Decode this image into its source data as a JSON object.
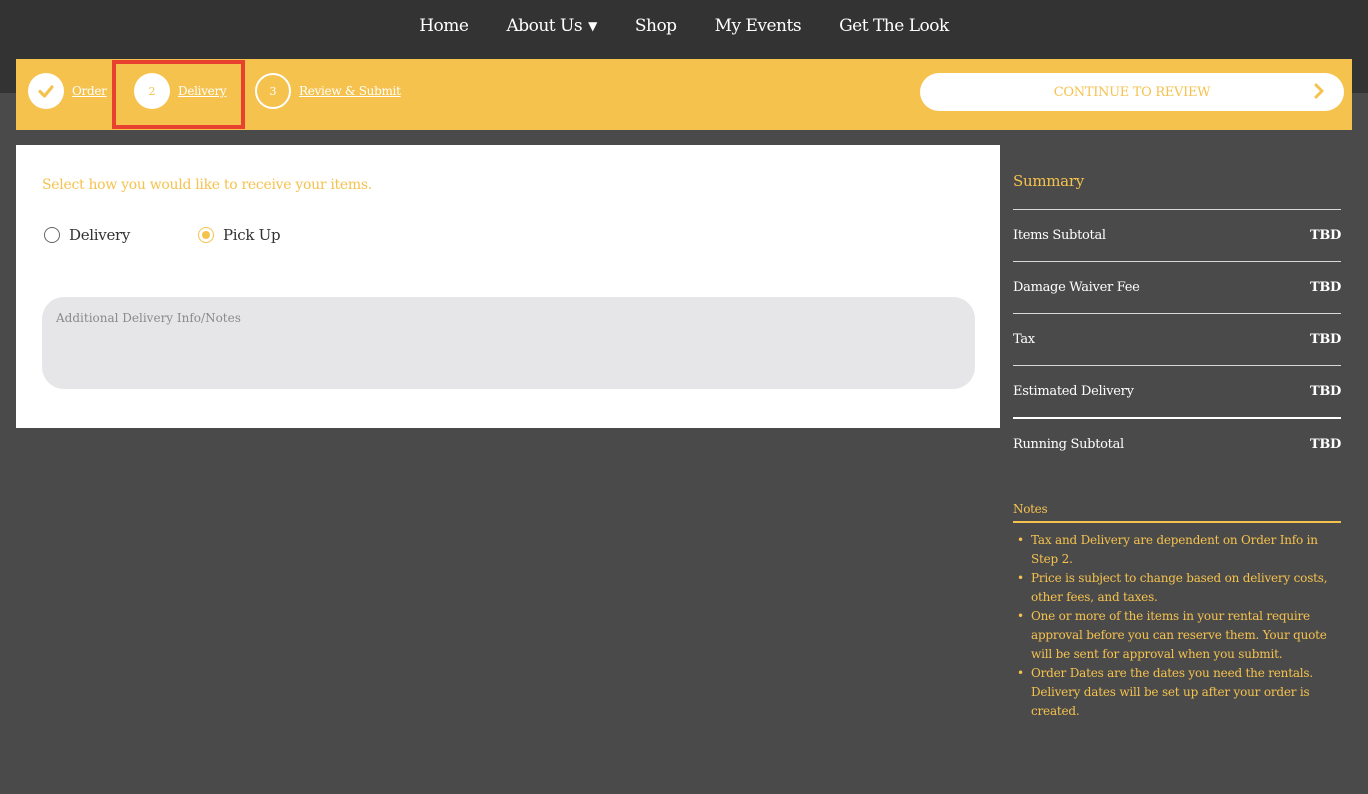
{
  "nav": {
    "items": [
      {
        "label": "Home"
      },
      {
        "label": "About Us",
        "has_dropdown": true
      },
      {
        "label": "Shop"
      },
      {
        "label": "My Events"
      },
      {
        "label": "Get The Look"
      }
    ],
    "dropdown_glyph": "▼"
  },
  "steps": [
    {
      "number": "",
      "label": "Order",
      "state": "done",
      "icon": "check-icon"
    },
    {
      "number": "2",
      "label": "Delivery",
      "state": "current"
    },
    {
      "number": "3",
      "label": "Review & Submit",
      "state": "todo"
    }
  ],
  "continue_button": {
    "label": "CONTINUE TO REVIEW",
    "icon": "chevron-right-icon"
  },
  "delivery": {
    "prompt": "Select how you would like to receive your items.",
    "options": [
      {
        "label": "Delivery",
        "checked": false
      },
      {
        "label": "Pick Up",
        "checked": true
      }
    ],
    "notes_placeholder": "Additional Delivery Info/Notes"
  },
  "summary": {
    "title": "Summary",
    "rows": [
      {
        "label": "Items Subtotal",
        "value": "TBD"
      },
      {
        "label": "Damage Waiver Fee",
        "value": "TBD"
      },
      {
        "label": "Tax",
        "value": "TBD"
      },
      {
        "label": "Estimated Delivery",
        "value": "TBD"
      },
      {
        "label": "Running Subtotal",
        "value": "TBD"
      }
    ]
  },
  "notes": {
    "title": "Notes",
    "items": [
      "Tax and Delivery are dependent on Order Info in Step 2.",
      "Price is subject to change based on delivery costs, other fees, and taxes.",
      "One or more of the items in your rental require approval before you can reserve them. Your quote will be sent for approval when you submit.",
      "Order Dates are the dates you need the rentals. Delivery dates will be set up after your order is created."
    ]
  },
  "colors": {
    "accent": "#f5c24e",
    "background": "#4a4a4a",
    "header": "#333333",
    "highlight": "#e8412f"
  }
}
